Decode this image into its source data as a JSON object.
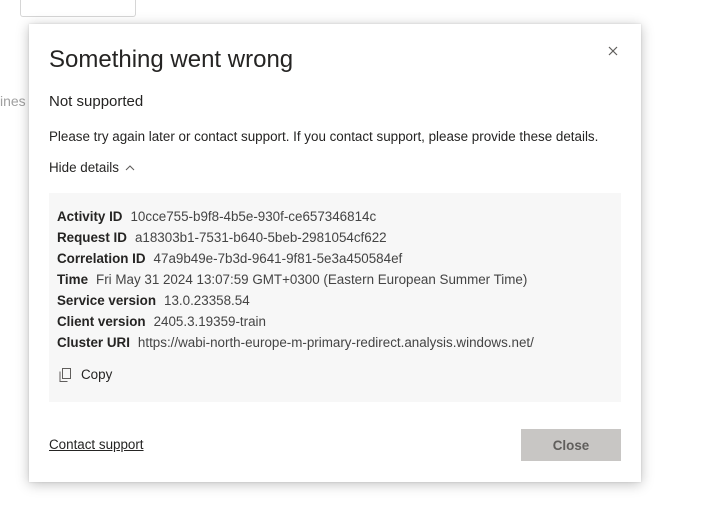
{
  "background": {
    "partial_text": "ines"
  },
  "dialog": {
    "title": "Something went wrong",
    "subtitle": "Not supported",
    "message": "Please try again later or contact support. If you contact support, please provide these details.",
    "toggle_label": "Hide details",
    "details": [
      {
        "key": "Activity ID",
        "value": "10cce755-b9f8-4b5e-930f-ce657346814c"
      },
      {
        "key": "Request ID",
        "value": "a18303b1-7531-b640-5beb-2981054cf622"
      },
      {
        "key": "Correlation ID",
        "value": "47a9b49e-7b3d-9641-9f81-5e3a450584ef"
      },
      {
        "key": "Time",
        "value": "Fri May 31 2024 13:07:59 GMT+0300 (Eastern European Summer Time)"
      },
      {
        "key": "Service version",
        "value": "13.0.23358.54"
      },
      {
        "key": "Client version",
        "value": "2405.3.19359-train"
      },
      {
        "key": "Cluster URI",
        "value": "https://wabi-north-europe-m-primary-redirect.analysis.windows.net/"
      }
    ],
    "copy_label": "Copy",
    "contact_label": "Contact support",
    "close_label": "Close"
  },
  "colors": {
    "close_button_bg": "#c8c6c4",
    "details_bg": "#f7f7f7",
    "text": "#252423"
  }
}
